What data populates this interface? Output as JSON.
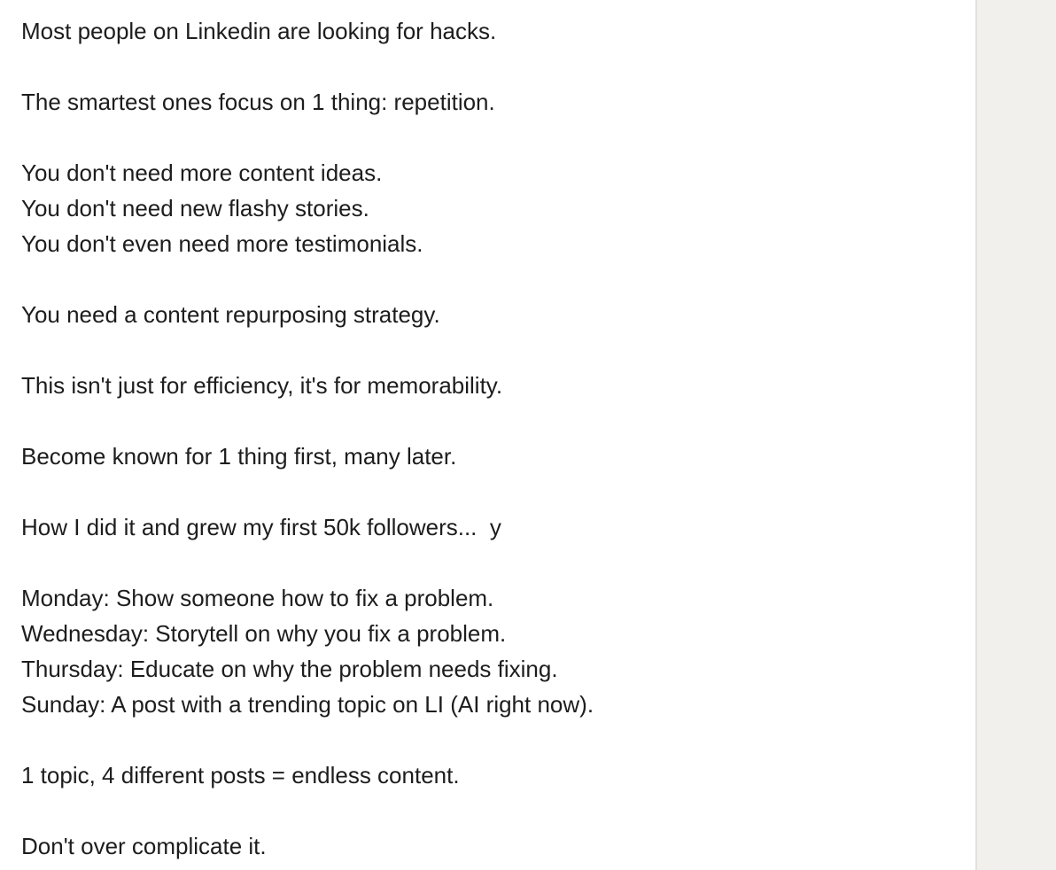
{
  "post": {
    "lines": {
      "l1": "Most people on Linkedin are looking for hacks.",
      "l2": "The smartest ones focus on 1 thing: repetition.",
      "l3": "You don't need more content ideas.",
      "l4": "You don't need new flashy stories.",
      "l5": "You don't even need more testimonials.",
      "l6": "You need a content repurposing strategy.",
      "l7": "This isn't just for efficiency, it's for memorability.",
      "l8": "Become known for 1 thing first, many later.",
      "l9": "How I did it and grew my first 50k followers...  y",
      "l10": "Monday: Show someone how to fix a problem.",
      "l11": "Wednesday: Storytell on why you fix a problem.",
      "l12": "Thursday: Educate on why the problem needs fixing.",
      "l13": "Sunday: A post with a trending topic on LI (AI right now).",
      "l14": "1 topic, 4 different posts = endless content.",
      "l15": "Don't over complicate it."
    }
  },
  "colors": {
    "text": "#1d1d1d",
    "background": "#ffffff",
    "side_panel": "#f1f0ec",
    "side_panel_border": "#e2e1dc"
  }
}
